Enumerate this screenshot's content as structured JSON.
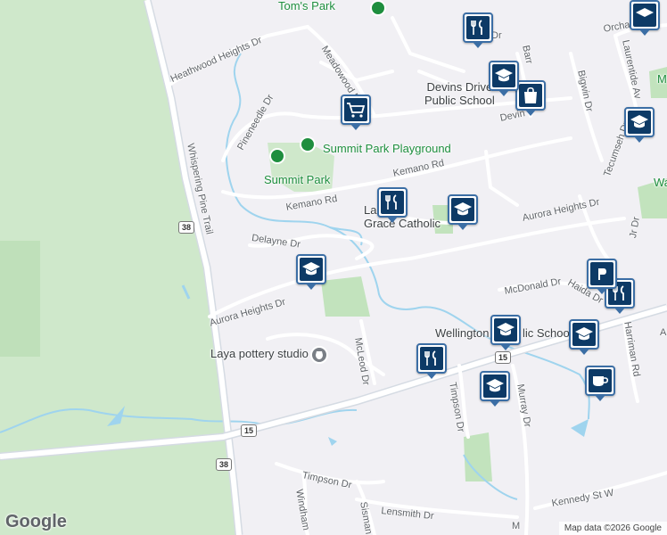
{
  "parks": [
    "Tom's Park",
    "Summit Park Playground",
    "Summit Park"
  ],
  "roads": [
    "Meadowood Dr",
    "Heathwood Heights Dr",
    "Pineneedle Dr",
    "Whispering Pine Trail",
    "Kemano Rd",
    "Kemano Rd",
    "Delayne Dr",
    "Aurora Heights Dr",
    "Aurora Heights Dr",
    "McLeod Dr",
    "Timpson Dr",
    "Timpson Dr",
    "Windham",
    "Sisman",
    "Lensmith Dr",
    "Kennedy St W",
    "McDonald Dr",
    "Haida Dr",
    "Murray Dr",
    "Bigwin Dr",
    "Laurentide Av",
    "Tecumseh Dr",
    "Orchard",
    "Barr",
    "Devin",
    "Harriman Rd",
    "Jr Dr",
    "Dr"
  ],
  "highways": [
    "38",
    "15",
    "15",
    "38"
  ],
  "places": {
    "devins": "Devins Drive\nPublic School",
    "lady": "Lady of\nGrace Catholic",
    "wellington": "Wellington",
    "wellington2": "lic School",
    "laya": "Laya pottery studio"
  },
  "edge_labels": [
    "M",
    "Wa",
    "A",
    "M"
  ],
  "google": "Google",
  "attribution": "Map data ©2026 Google",
  "icons": {
    "tree": "tree-icon",
    "fork_knife": "fork-knife-icon",
    "cart": "shopping-cart-icon",
    "bag": "shopping-bag-icon",
    "school": "school-icon",
    "coffee": "coffee-icon",
    "pottery": "pottery-icon",
    "parking": "parking-icon"
  },
  "colors": {
    "water": "#9fd4ee",
    "park": "#d7ecd3",
    "green_area": "#bfe3bc",
    "pin_border": "#3b6ea5",
    "pin_fill": "#0d3a66",
    "road": "#ffffff",
    "highway": "#d5dbe3"
  }
}
